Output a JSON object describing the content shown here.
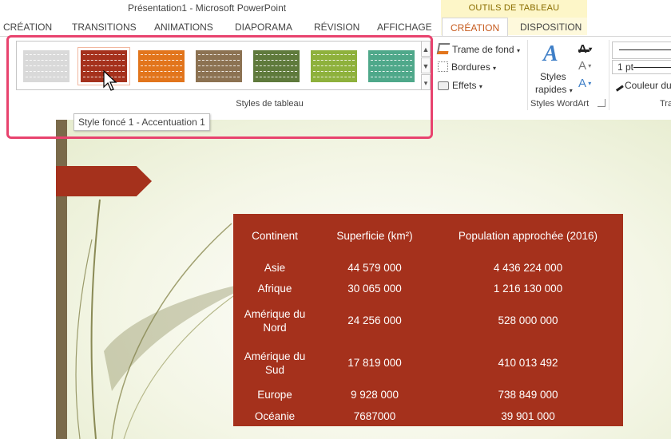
{
  "window": {
    "title": "Présentation1 - Microsoft PowerPoint"
  },
  "context": {
    "label": "OUTILS DE TABLEAU"
  },
  "tabs": [
    {
      "label": "CRÉATION"
    },
    {
      "label": "TRANSITIONS"
    },
    {
      "label": "ANIMATIONS"
    },
    {
      "label": "DIAPORAMA"
    },
    {
      "label": "RÉVISION"
    },
    {
      "label": "AFFICHAGE"
    },
    {
      "label": "CRÉATION"
    },
    {
      "label": "DISPOSITION"
    }
  ],
  "ribbon": {
    "table_styles": {
      "group_label": "Styles de tableau",
      "swatches": [
        {
          "color": "#d9d9d9"
        },
        {
          "color": "#a5311c"
        },
        {
          "color": "#e2751c"
        },
        {
          "color": "#8c7252"
        },
        {
          "color": "#5f7a3c"
        },
        {
          "color": "#8eb13c"
        },
        {
          "color": "#4fa88a"
        }
      ]
    },
    "shading": {
      "label": "Trame de fond"
    },
    "borders": {
      "label": "Bordures"
    },
    "effects": {
      "label": "Effets"
    },
    "quick_styles": {
      "line1": "Styles",
      "line2": "rapides"
    },
    "wordart_group_label": "Styles WordArt",
    "pen_weight": "1 pt",
    "pen_color": "Couleur du",
    "truncated_label": "Tra"
  },
  "tooltip": {
    "text": "Style foncé 1 - Accentuation 1"
  },
  "table": {
    "headers": [
      "Continent",
      "Superficie (km²)",
      "Population approchée (2016)"
    ],
    "rows": [
      [
        "Asie",
        "44 579 000",
        "4 436 224 000"
      ],
      [
        "Afrique",
        "30 065 000",
        "1 216 130 000"
      ],
      [
        "Amérique du Nord",
        "24 256 000",
        "528 000 000"
      ],
      [
        "Amérique du Sud",
        "17 819 000",
        "410 013 492"
      ],
      [
        "Europe",
        "9 928 000",
        "738 849 000"
      ],
      [
        "Océanie",
        "7687000",
        "39 901 000"
      ]
    ]
  },
  "colors": {
    "accent_table": "#a5311c",
    "highlight_frame": "#e8436e",
    "active_tab_text": "#c65a1d",
    "context_band": "#fdf6c8"
  }
}
